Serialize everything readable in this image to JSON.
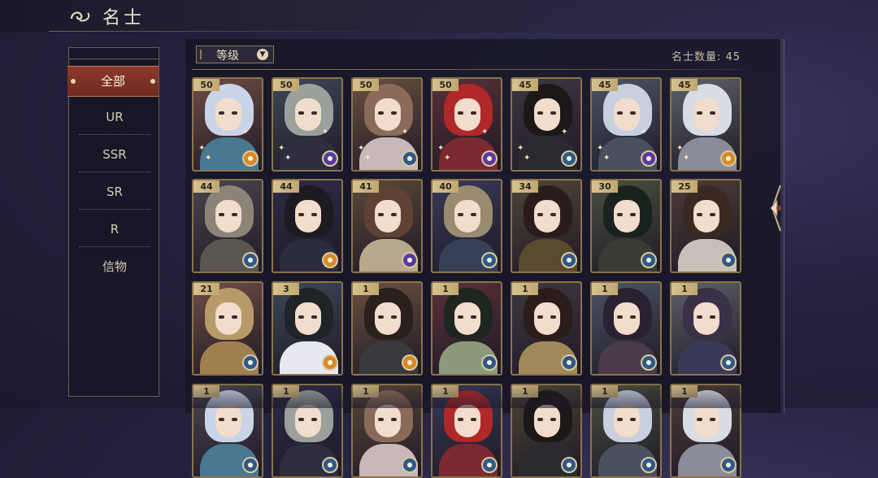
{
  "header": {
    "title": "名士",
    "icon": "cloud-swirl-icon"
  },
  "sidebar": {
    "items": [
      {
        "label": "全部",
        "active": true
      },
      {
        "label": "UR",
        "active": false
      },
      {
        "label": "SSR",
        "active": false
      },
      {
        "label": "SR",
        "active": false
      },
      {
        "label": "R",
        "active": false
      },
      {
        "label": "信物",
        "active": false
      }
    ]
  },
  "sort": {
    "label": "等级",
    "icon": "chevron-down-icon"
  },
  "count": {
    "label": "名士数量: 45"
  },
  "colors": {
    "accent_red": "#8c3a2a",
    "gold_border": "#8a734a",
    "level_tag": "#d6c290"
  },
  "cards": [
    {
      "level": "50",
      "element": "gold"
    },
    {
      "level": "50",
      "element": "purple"
    },
    {
      "level": "50",
      "element": "blue"
    },
    {
      "level": "50",
      "element": "purple"
    },
    {
      "level": "45",
      "element": "blue"
    },
    {
      "level": "45",
      "element": "purple"
    },
    {
      "level": "45",
      "element": "gold"
    },
    {
      "level": "44",
      "element": "blue"
    },
    {
      "level": "44",
      "element": "gold"
    },
    {
      "level": "41",
      "element": "purple"
    },
    {
      "level": "40",
      "element": "blue"
    },
    {
      "level": "34",
      "element": "blue"
    },
    {
      "level": "30",
      "element": "blue"
    },
    {
      "level": "25",
      "element": "blue"
    },
    {
      "level": "21",
      "element": "blue"
    },
    {
      "level": "3",
      "element": "gold"
    },
    {
      "level": "1",
      "element": "gold"
    },
    {
      "level": "1",
      "element": "blue"
    },
    {
      "level": "1",
      "element": "blue"
    },
    {
      "level": "1",
      "element": "blue"
    },
    {
      "level": "1",
      "element": "blue"
    },
    {
      "level": "1",
      "element": "blue"
    },
    {
      "level": "1",
      "element": "blue"
    },
    {
      "level": "1",
      "element": "blue"
    },
    {
      "level": "1",
      "element": "blue"
    },
    {
      "level": "1",
      "element": "blue"
    },
    {
      "level": "1",
      "element": "blue"
    },
    {
      "level": "1",
      "element": "blue"
    }
  ]
}
